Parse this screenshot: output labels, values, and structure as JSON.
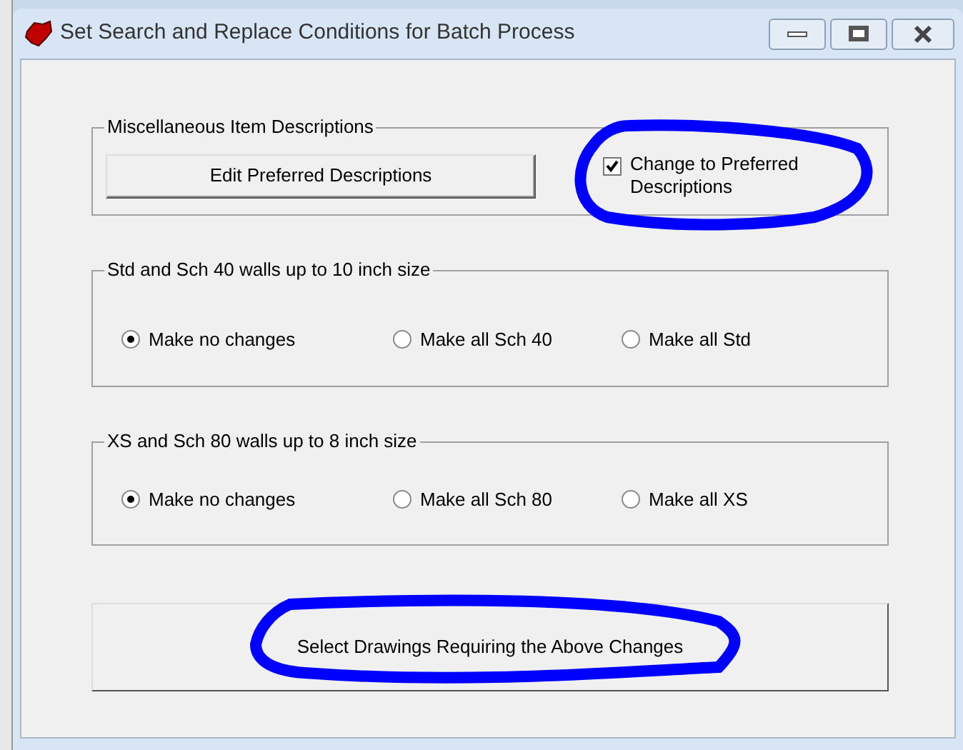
{
  "window": {
    "title": "Set Search and Replace Conditions for Batch Process"
  },
  "misc_group": {
    "title": "Miscellaneous Item Descriptions",
    "button": "Edit Preferred Descriptions",
    "checkbox": {
      "label": "Change to Preferred Descriptions",
      "checked": true
    }
  },
  "radio_groups": [
    {
      "title": "Std and Sch 40 walls up to 10 inch size",
      "options": [
        {
          "label": "Make no changes",
          "selected": true
        },
        {
          "label": "Make all Sch 40",
          "selected": false
        },
        {
          "label": "Make all Std",
          "selected": false
        }
      ]
    },
    {
      "title": "XS and Sch 80 walls up to 8 inch size",
      "options": [
        {
          "label": "Make no changes",
          "selected": true
        },
        {
          "label": "Make all Sch 80",
          "selected": false
        },
        {
          "label": "Make all XS",
          "selected": false
        }
      ]
    }
  ],
  "action_button": "Select Drawings Requiring the Above Changes"
}
